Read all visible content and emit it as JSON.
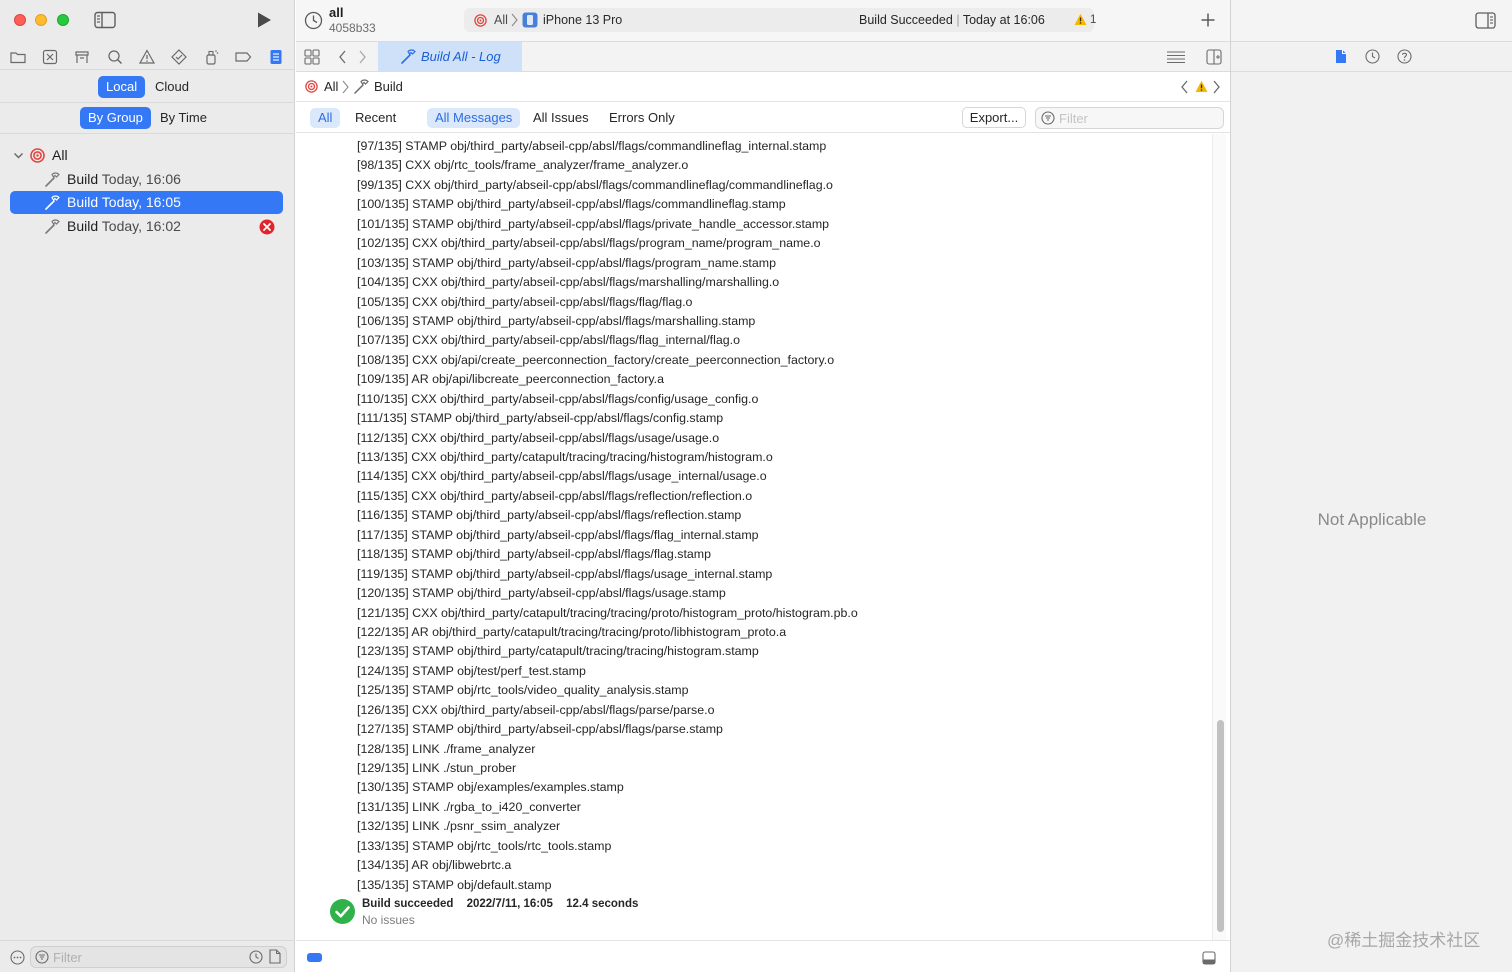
{
  "window": {
    "scheme_name": "all",
    "commit": "4058b33",
    "destination_group": "All",
    "destination_device": "iPhone 13 Pro",
    "status_text": "Build Succeeded",
    "status_separator": "|",
    "status_time": "Today at 16:06",
    "warning_count": "1"
  },
  "navigator": {
    "segment_source": [
      "Local",
      "Cloud"
    ],
    "segment_source_selected": "Local",
    "segment_group": [
      "By Group",
      "By Time"
    ],
    "segment_group_selected": "By Group",
    "tree_root": "All",
    "builds": [
      {
        "label": "Build",
        "time": "Today, 16:06",
        "selected": false,
        "error": false
      },
      {
        "label": "Build",
        "time": "Today, 16:05",
        "selected": true,
        "error": false
      },
      {
        "label": "Build",
        "time": "Today, 16:02",
        "selected": false,
        "error": true
      }
    ],
    "filter_placeholder": "Filter"
  },
  "editor": {
    "tab_title": "Build All - Log",
    "breadcrumb": [
      "All",
      "Build"
    ],
    "filters": [
      "All",
      "Recent"
    ],
    "filter_selected": "All",
    "message_filters": [
      "All Messages",
      "All Issues",
      "Errors Only"
    ],
    "message_filter_selected": "All Messages",
    "export_label": "Export...",
    "filter_placeholder": "Filter"
  },
  "log_lines": [
    "[97/135] STAMP obj/third_party/abseil-cpp/absl/flags/commandlineflag_internal.stamp",
    "[98/135] CXX obj/rtc_tools/frame_analyzer/frame_analyzer.o",
    "[99/135] CXX obj/third_party/abseil-cpp/absl/flags/commandlineflag/commandlineflag.o",
    "[100/135] STAMP obj/third_party/abseil-cpp/absl/flags/commandlineflag.stamp",
    "[101/135] STAMP obj/third_party/abseil-cpp/absl/flags/private_handle_accessor.stamp",
    "[102/135] CXX obj/third_party/abseil-cpp/absl/flags/program_name/program_name.o",
    "[103/135] STAMP obj/third_party/abseil-cpp/absl/flags/program_name.stamp",
    "[104/135] CXX obj/third_party/abseil-cpp/absl/flags/marshalling/marshalling.o",
    "[105/135] CXX obj/third_party/abseil-cpp/absl/flags/flag/flag.o",
    "[106/135] STAMP obj/third_party/abseil-cpp/absl/flags/marshalling.stamp",
    "[107/135] CXX obj/third_party/abseil-cpp/absl/flags/flag_internal/flag.o",
    "[108/135] CXX obj/api/create_peerconnection_factory/create_peerconnection_factory.o",
    "[109/135] AR obj/api/libcreate_peerconnection_factory.a",
    "[110/135] CXX obj/third_party/abseil-cpp/absl/flags/config/usage_config.o",
    "[111/135] STAMP obj/third_party/abseil-cpp/absl/flags/config.stamp",
    "[112/135] CXX obj/third_party/abseil-cpp/absl/flags/usage/usage.o",
    "[113/135] CXX obj/third_party/catapult/tracing/tracing/histogram/histogram.o",
    "[114/135] CXX obj/third_party/abseil-cpp/absl/flags/usage_internal/usage.o",
    "[115/135] CXX obj/third_party/abseil-cpp/absl/flags/reflection/reflection.o",
    "[116/135] STAMP obj/third_party/abseil-cpp/absl/flags/reflection.stamp",
    "[117/135] STAMP obj/third_party/abseil-cpp/absl/flags/flag_internal.stamp",
    "[118/135] STAMP obj/third_party/abseil-cpp/absl/flags/flag.stamp",
    "[119/135] STAMP obj/third_party/abseil-cpp/absl/flags/usage_internal.stamp",
    "[120/135] STAMP obj/third_party/abseil-cpp/absl/flags/usage.stamp",
    "[121/135] CXX obj/third_party/catapult/tracing/tracing/proto/histogram_proto/histogram.pb.o",
    "[122/135] AR obj/third_party/catapult/tracing/tracing/proto/libhistogram_proto.a",
    "[123/135] STAMP obj/third_party/catapult/tracing/tracing/histogram.stamp",
    "[124/135] STAMP obj/test/perf_test.stamp",
    "[125/135] STAMP obj/rtc_tools/video_quality_analysis.stamp",
    "[126/135] CXX obj/third_party/abseil-cpp/absl/flags/parse/parse.o",
    "[127/135] STAMP obj/third_party/abseil-cpp/absl/flags/parse.stamp",
    "[128/135] LINK ./frame_analyzer",
    "[129/135] LINK ./stun_prober",
    "[130/135] STAMP obj/examples/examples.stamp",
    "[131/135] LINK ./rgba_to_i420_converter",
    "[132/135] LINK ./psnr_ssim_analyzer",
    "[133/135] STAMP obj/rtc_tools/rtc_tools.stamp",
    "[134/135] AR obj/libwebrtc.a",
    "[135/135] STAMP obj/default.stamp"
  ],
  "summary": {
    "title": "Build succeeded",
    "date": "2022/7/11, 16:05",
    "duration": "12.4 seconds",
    "issues": "No issues"
  },
  "inspector": {
    "empty_text": "Not Applicable"
  },
  "watermark": "@稀土掘金技术社区",
  "colors": {
    "accent": "#3478f6",
    "success": "#30b14a",
    "error": "#e0262c",
    "warning": "#f5b800",
    "build_target": "#e0473e"
  }
}
